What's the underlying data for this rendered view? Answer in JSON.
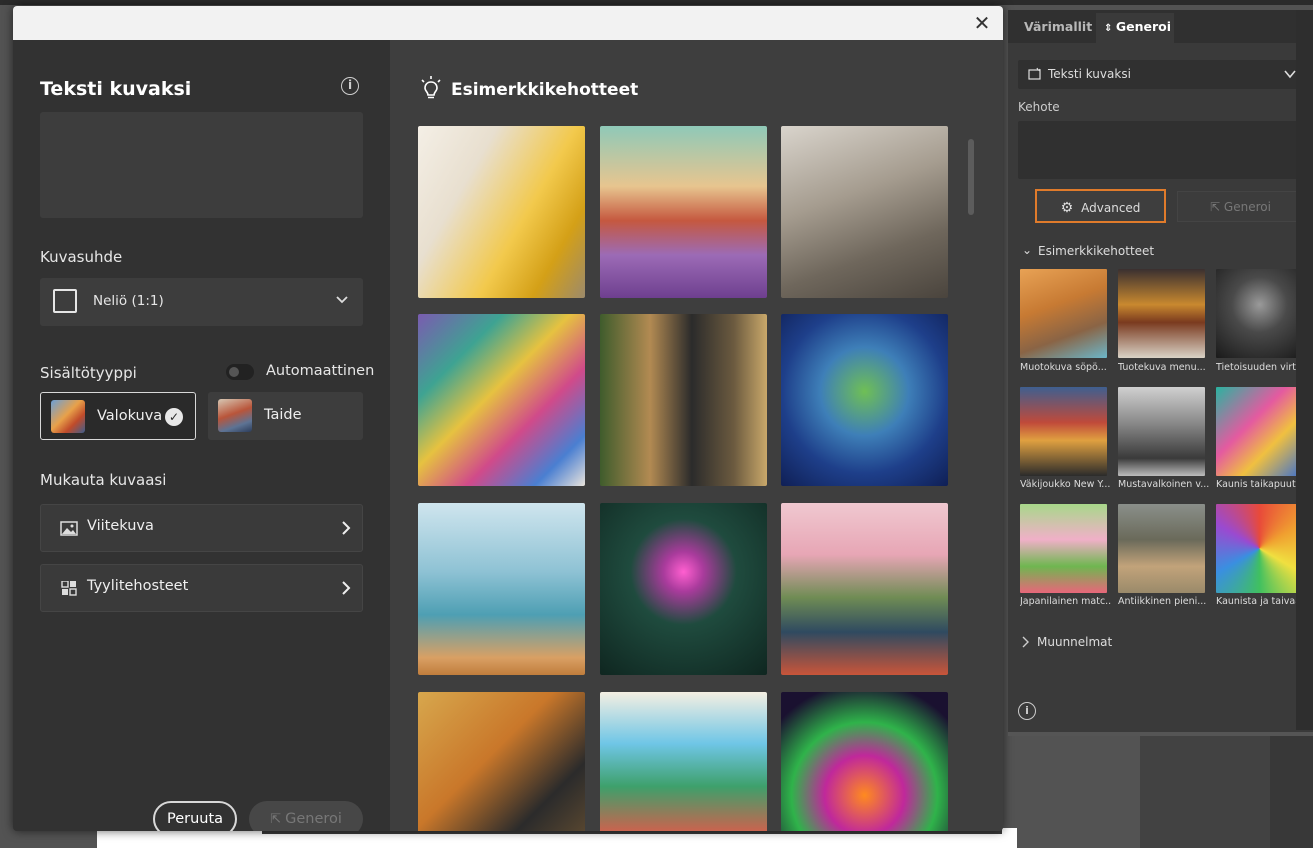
{
  "dialog": {
    "title": "Teksti kuvaksi",
    "close_glyph": "✕",
    "info_glyph": "i",
    "aspect_label": "Kuvasuhde",
    "aspect_value": "Neliö (1:1)",
    "content_type_label": "Sisältötyyppi",
    "auto_label": "Automaattinen",
    "content_types": [
      "Valokuva",
      "Taide"
    ],
    "customize_label": "Mukauta kuvaasi",
    "reference_label": "Viitekuva",
    "style_label": "Tyylitehosteet",
    "cancel_label": "Peruuta",
    "generate_label": "Generoi",
    "examples_title": "Esimerkkikehotteet"
  },
  "panel": {
    "tabs": [
      "Värimallit",
      "Generoi"
    ],
    "dropdown_value": "Teksti kuvaksi",
    "prompt_label": "Kehote",
    "advanced_label": "Advanced",
    "generate_label": "Generoi",
    "examples_label": "Esimerkkikehotteet",
    "examples": [
      "Muotokuva söpö...",
      "Tuotekuva menu...",
      "Tietoisuuden virt...",
      "Väkijoukko New Y...",
      "Mustavalkoinen v...",
      "Kaunis taikapuuta...",
      "Japanilainen matc...",
      "Antiikkinen pieni...",
      "Kaunista ja taivaal..."
    ],
    "variations_label": "Muunnelmat",
    "info_glyph": "i"
  },
  "colors": {
    "accent_orange": "#e07b2b",
    "dialog_bg": "#323232"
  }
}
